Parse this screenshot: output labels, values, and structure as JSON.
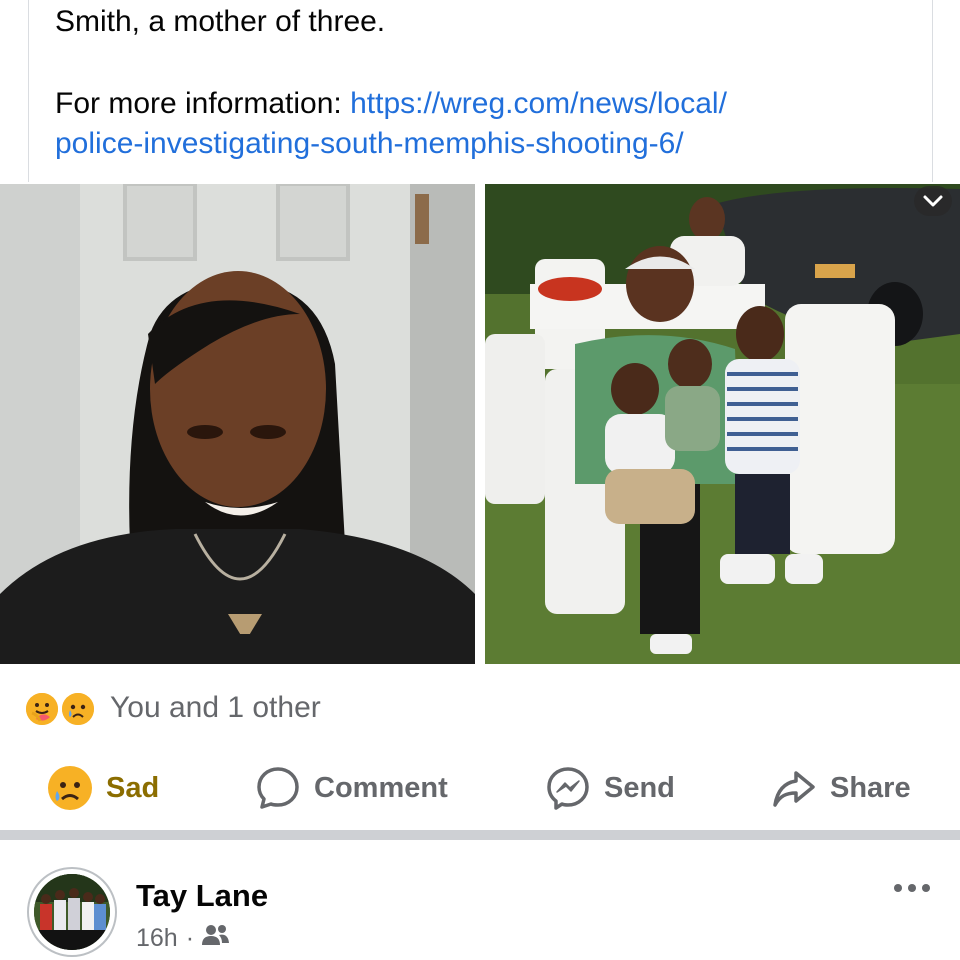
{
  "shared_post": {
    "line1": "Smith, a mother of three.",
    "info_label": "For more information: ",
    "link_part1": "https://wreg.com/news/local/",
    "link_part2": "police-investigating-south-memphis-shooting-6/"
  },
  "photos": [
    {
      "icon": "woman-selfie-photo"
    },
    {
      "icon": "family-party-photo",
      "overlay_icon": "chevron-down-icon"
    }
  ],
  "reactions": {
    "icons": [
      "care-reaction-icon",
      "sad-reaction-icon"
    ],
    "summary": "You and 1 other"
  },
  "actions": {
    "sad": "Sad",
    "comment": "Comment",
    "send": "Send",
    "share": "Share"
  },
  "next_post": {
    "author": "Tay Lane",
    "time": "16h",
    "separator": "·",
    "audience_icon": "friends-icon"
  },
  "colors": {
    "link": "#216fdb",
    "secondary_text": "#65676b",
    "sad_active": "#8b6d00",
    "divider": "#ced0d4"
  }
}
